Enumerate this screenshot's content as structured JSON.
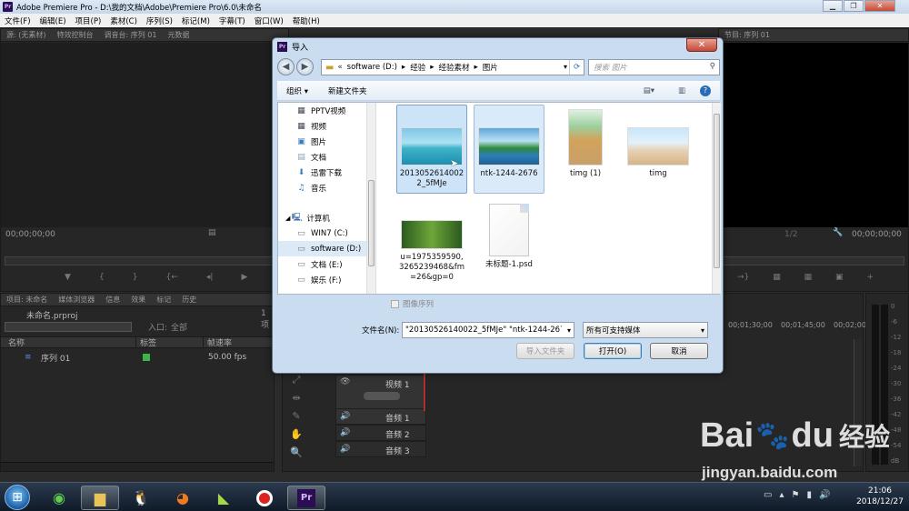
{
  "app": {
    "title": "Adobe Premiere Pro - D:\\我的文档\\Adobe\\Premiere Pro\\6.0\\未命名",
    "logo": "Pr"
  },
  "menu": [
    "文件(F)",
    "编辑(E)",
    "项目(P)",
    "素材(C)",
    "序列(S)",
    "标记(M)",
    "字幕(T)",
    "窗口(W)",
    "帮助(H)"
  ],
  "source_panel": {
    "tabs": [
      "源: (无素材)",
      "特效控制台",
      "调音台: 序列 01",
      "元数据"
    ],
    "timecode": "00;00;00;00"
  },
  "program_panel": {
    "tab": "节目: 序列 01",
    "timecode_right": "00;00;00;00",
    "zoom": "1/2"
  },
  "project_panel": {
    "tabs": [
      "项目: 未命名",
      "媒体浏览器",
      "信息",
      "效果",
      "标记",
      "历史"
    ],
    "file": "未命名.prproj",
    "items_count": "1 项",
    "inpoint_label": "入口:",
    "inpoint_value": "全部",
    "columns": [
      "名称",
      "标签",
      "帧速率"
    ],
    "rows": [
      {
        "name": "序列 01",
        "label_color": "#3bb54a",
        "fps": "50.00 fps"
      }
    ]
  },
  "timeline": {
    "ruler": [
      "00;01;30;00",
      "00;01;45;00",
      "00;02;00;00"
    ],
    "tracks": [
      {
        "name": "视频 1",
        "kind": "video"
      },
      {
        "name": "音频 1",
        "kind": "audio"
      },
      {
        "name": "音频 2",
        "kind": "audio"
      },
      {
        "name": "音频 3",
        "kind": "audio"
      }
    ],
    "meter_labels": [
      "0",
      "-6",
      "-12",
      "-18",
      "-24",
      "-30",
      "-36",
      "-42",
      "-48",
      "-54",
      "dB"
    ]
  },
  "dialog": {
    "title": "导入",
    "close_label": "✕",
    "breadcrumb": [
      "«",
      "software (D:)",
      "经验",
      "经验素材",
      "图片"
    ],
    "search_placeholder": "搜索 图片",
    "toolbar": {
      "organize": "组织 ▾",
      "new_folder": "新建文件夹"
    },
    "nav_items": [
      {
        "label": "PPTV视频",
        "icon": "video-folder-icon"
      },
      {
        "label": "视频",
        "icon": "video-folder-icon"
      },
      {
        "label": "图片",
        "icon": "pictures-folder-icon"
      },
      {
        "label": "文档",
        "icon": "documents-folder-icon"
      },
      {
        "label": "迅雷下载",
        "icon": "download-folder-icon"
      },
      {
        "label": "音乐",
        "icon": "music-folder-icon"
      }
    ],
    "computer_label": "计算机",
    "drives": [
      {
        "label": "WIN7 (C:)"
      },
      {
        "label": "software (D:)",
        "selected": true
      },
      {
        "label": "文档 (E:)"
      },
      {
        "label": "娱乐 (F:)"
      }
    ],
    "files": [
      {
        "label": "20130526140022_5fMJe",
        "thumb": "island"
      },
      {
        "label": "ntk-1244-2676",
        "thumb": "lake"
      },
      {
        "label": "timg (1)",
        "thumb": "woman-tall"
      },
      {
        "label": "timg",
        "thumb": "beach"
      },
      {
        "label": "u=1975359590,3265239468&fm=26&gp=0",
        "thumb": "forest"
      },
      {
        "label": "未标题-1.psd",
        "thumb": "psd"
      }
    ],
    "image_sequence_label": "图像序列",
    "filename_label": "文件名(N):",
    "filename_value": "\"20130526140022_5fMJe\" \"ntk-1244-267",
    "filetype_value": "所有可支持媒体",
    "import_folder_label": "导入文件夹",
    "open_label": "打开(O)",
    "cancel_label": "取消"
  },
  "taskbar": {
    "time": "21:06",
    "date": "2018/12/27"
  },
  "watermark": {
    "brand": "Bai",
    "brand2": "du",
    "cn": "经验",
    "url": "jingyan.baidu.com"
  }
}
